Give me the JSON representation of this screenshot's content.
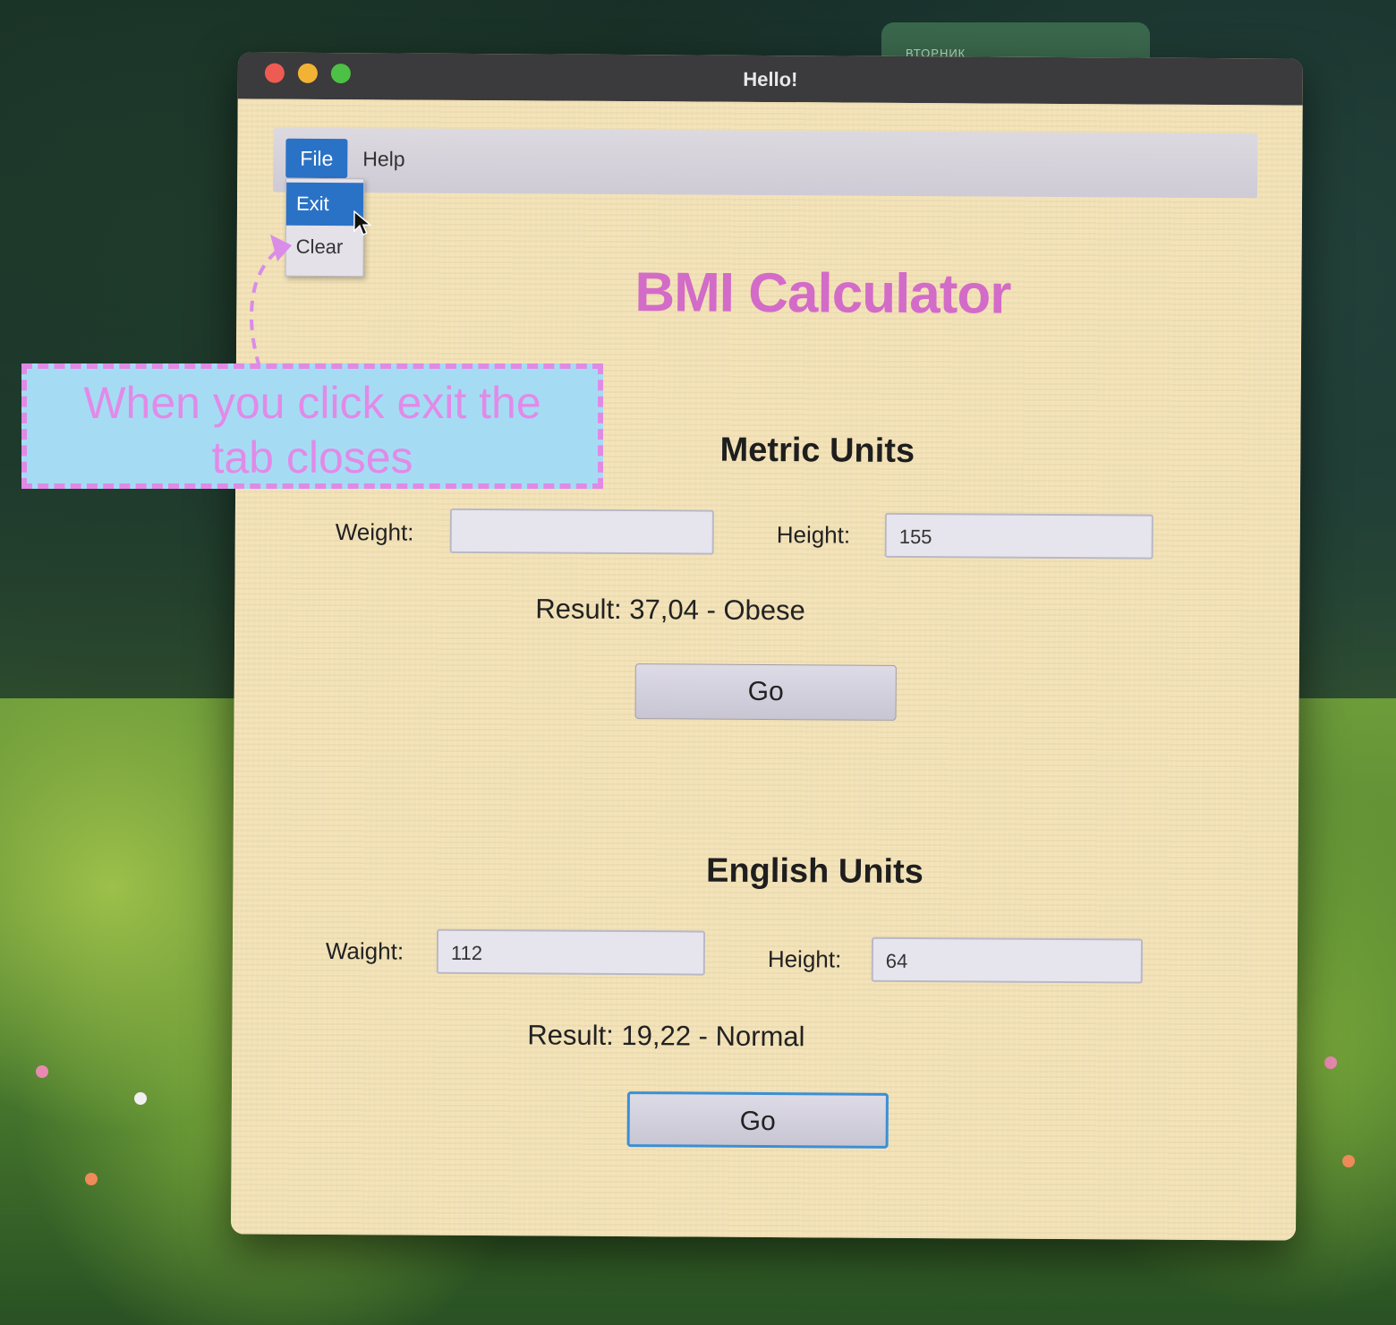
{
  "background_tab": {
    "label": "ВТОРНИК"
  },
  "window": {
    "title": "Hello!"
  },
  "menu": {
    "file": "File",
    "help": "Help",
    "dropdown": [
      {
        "label": "Exit"
      },
      {
        "label": "Clear"
      }
    ]
  },
  "app_title": "BMI Calculator",
  "metric": {
    "title": "Metric Units",
    "weight_label": "Weight:",
    "weight_value": "",
    "height_label": "Height:",
    "height_value": "155",
    "result": "Result: 37,04 - Obese",
    "go": "Go"
  },
  "english": {
    "title": "English Units",
    "weight_label": "Waight:",
    "weight_value": "112",
    "height_label": "Height:",
    "height_value": "64",
    "result": "Result: 19,22 - Normal",
    "go": "Go"
  },
  "annotation": {
    "line1": "When you  click exit the",
    "line2": "tab closes"
  },
  "colors": {
    "accent": "#2a72c6",
    "title": "#d36bc8",
    "window_bg": "#f3e2b6",
    "annotation_bg": "#a6dcf3",
    "annotation_border": "#e08ae6"
  }
}
